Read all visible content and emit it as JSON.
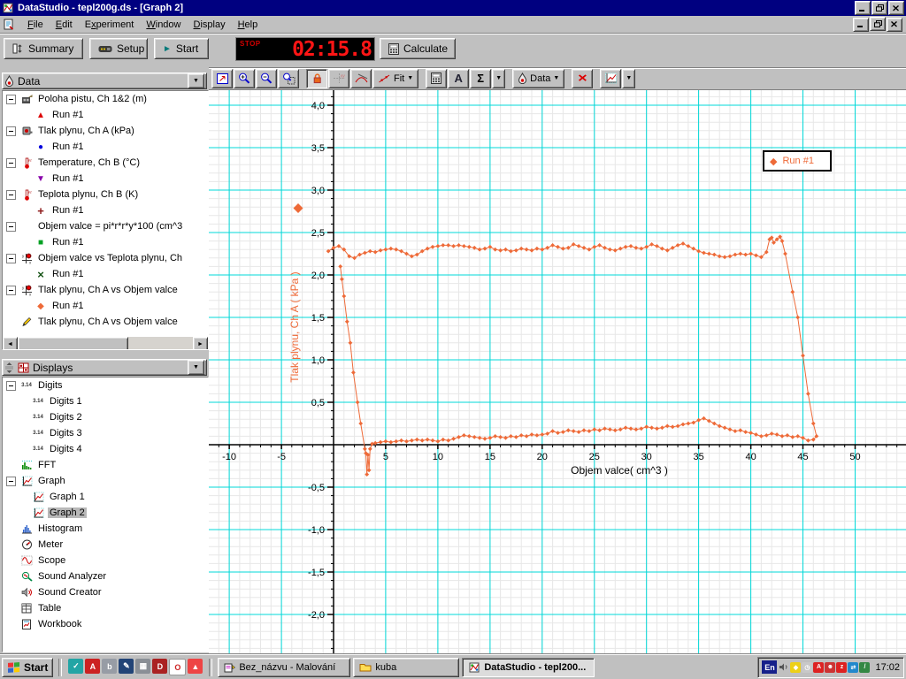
{
  "window": {
    "title": "DataStudio - tepl200g.ds - [Graph 2]",
    "app_icon": "datastudio-icon",
    "controls": [
      "minimize",
      "restore",
      "close"
    ],
    "child_controls": [
      "minimize",
      "restore",
      "close"
    ]
  },
  "menu": {
    "doc_icon": "document-icon",
    "items": [
      {
        "label": "File",
        "u": 0
      },
      {
        "label": "Edit",
        "u": 0
      },
      {
        "label": "Experiment",
        "u": 1
      },
      {
        "label": "Window",
        "u": 0
      },
      {
        "label": "Display",
        "u": 0
      },
      {
        "label": "Help",
        "u": 0
      }
    ]
  },
  "toolbar": {
    "summary_label": "Summary",
    "setup_label": "Setup",
    "start_label": "Start",
    "timer": {
      "status": "STOP",
      "value": "02:15.8"
    },
    "calculate_label": "Calculate"
  },
  "graph_toolbar": {
    "buttons": [
      {
        "name": "scale-to-fit"
      },
      {
        "name": "zoom-in"
      },
      {
        "name": "zoom-out"
      },
      {
        "name": "zoom-select"
      },
      {
        "name": "smart-tool",
        "pressed": true,
        "gapBefore": true
      },
      {
        "name": "xy-tool",
        "disabled": true
      },
      {
        "name": "slope-tool"
      },
      {
        "name": "fit",
        "label": "Fit",
        "arrow": true
      },
      {
        "name": "calculator",
        "gapBefore": true
      },
      {
        "name": "text-tool"
      },
      {
        "name": "statistics"
      },
      {
        "name": "statistics-arrow",
        "arrowOnly": true
      },
      {
        "name": "data",
        "label": "Data",
        "arrow": true,
        "gapBefore": true
      },
      {
        "name": "delete",
        "gapBefore": true
      },
      {
        "name": "graph-settings",
        "gapBefore": true
      },
      {
        "name": "graph-settings-arrow",
        "arrowOnly": true
      }
    ]
  },
  "sidebar": {
    "data_panel": {
      "title": "Data",
      "header_icon": "droplet-icon",
      "items": [
        {
          "icon": "motion-sensor",
          "label": "Poloha pistu, Ch 1&2 (m)",
          "expand": true,
          "runs": [
            {
              "marker": "triangle-up",
              "color": "#dd0000",
              "label": "Run #1"
            }
          ]
        },
        {
          "icon": "pressure-sensor",
          "label": "Tlak plynu, Ch A (kPa)",
          "expand": true,
          "runs": [
            {
              "marker": "circle",
              "color": "#0000dd",
              "label": "Run #1"
            }
          ]
        },
        {
          "icon": "thermometer",
          "label": "Temperature, Ch B (°C)",
          "expand": true,
          "runs": [
            {
              "marker": "triangle-down",
              "color": "#8800aa",
              "label": "Run #1"
            }
          ]
        },
        {
          "icon": "thermometer",
          "label": "Teplota plynu, Ch B (K)",
          "expand": true,
          "runs": [
            {
              "marker": "plus",
              "color": "#8b1515",
              "label": "Run #1"
            }
          ]
        },
        {
          "icon": "calculator",
          "label": "Objem valce = pi*r*r*y*100 (cm^3",
          "expand": true,
          "runs": [
            {
              "marker": "square",
              "color": "#00a022",
              "label": "Run #1"
            }
          ]
        },
        {
          "icon": "xy-graph",
          "label": "Objem valce vs Teplota plynu, Ch",
          "expand": true,
          "runs": [
            {
              "marker": "x",
              "color": "#145214",
              "label": "Run #1"
            }
          ]
        },
        {
          "icon": "xy-graph",
          "label": "Tlak plynu, Ch A vs Objem valce",
          "expand": true,
          "runs": [
            {
              "marker": "diamond",
              "color": "#ee6a38",
              "label": "Run #1"
            }
          ]
        },
        {
          "icon": "pencil",
          "label": "Tlak plynu, Ch A vs Objem valce",
          "expand": false,
          "runs": []
        }
      ]
    },
    "displays_panel": {
      "title": "Displays",
      "header_icon": "displays-grid-icon",
      "splitter_icon": "splitter-icon",
      "items": [
        {
          "icon": "digits",
          "label": "Digits",
          "expand": true,
          "children": [
            "Digits 1",
            "Digits 2",
            "Digits 3",
            "Digits 4"
          ]
        },
        {
          "icon": "fft",
          "label": "FFT"
        },
        {
          "icon": "graph",
          "label": "Graph",
          "expand": true,
          "children": [
            "Graph 1",
            "Graph 2"
          ],
          "selected_child": "Graph 2"
        },
        {
          "icon": "histogram",
          "label": "Histogram"
        },
        {
          "icon": "meter",
          "label": "Meter"
        },
        {
          "icon": "scope",
          "label": "Scope"
        },
        {
          "icon": "sound-analyzer",
          "label": "Sound Analyzer"
        },
        {
          "icon": "sound-creator",
          "label": "Sound Creator"
        },
        {
          "icon": "table",
          "label": "Table"
        },
        {
          "icon": "workbook",
          "label": "Workbook"
        }
      ]
    }
  },
  "chart_data": {
    "type": "scatter",
    "title": "",
    "xlabel": "Objem valce( cm^3 )",
    "ylabel": "Tlak plynu, Ch A ( kPa )",
    "decimal_separator": ",",
    "x_ticks": [
      -10,
      -5,
      5,
      10,
      15,
      20,
      25,
      30,
      35,
      40,
      45,
      50
    ],
    "y_ticks": [
      -2.0,
      -1.5,
      -1.0,
      -0.5,
      0.5,
      1.0,
      1.5,
      2.0,
      2.5,
      3.0,
      3.5,
      4.0
    ],
    "xlim": [
      -12,
      55
    ],
    "ylim": [
      -2.47,
      4.17
    ],
    "x_minor_step": 1,
    "y_minor_step": 0.1,
    "grid": {
      "major_color": "#00d8d8",
      "minor_color": "#e7e7e7"
    },
    "legend": [
      {
        "label": "Run #1",
        "marker": "diamond",
        "color": "#ee6a38"
      }
    ],
    "legend_position": "top-right",
    "series": [
      {
        "name": "Run #1",
        "color": "#ee6a38",
        "marker": "diamond",
        "points": [
          [
            -0.5,
            2.28
          ],
          [
            0,
            2.32
          ],
          [
            0.5,
            2.34
          ],
          [
            1,
            2.3
          ],
          [
            1.5,
            2.22
          ],
          [
            2,
            2.2
          ],
          [
            2.5,
            2.24
          ],
          [
            3,
            2.26
          ],
          [
            3.5,
            2.28
          ],
          [
            4,
            2.27
          ],
          [
            4.5,
            2.29
          ],
          [
            5,
            2.3
          ],
          [
            5.5,
            2.31
          ],
          [
            6,
            2.3
          ],
          [
            6.5,
            2.28
          ],
          [
            7,
            2.25
          ],
          [
            7.5,
            2.22
          ],
          [
            8,
            2.24
          ],
          [
            8.5,
            2.28
          ],
          [
            9,
            2.31
          ],
          [
            9.5,
            2.33
          ],
          [
            10,
            2.34
          ],
          [
            10.5,
            2.35
          ],
          [
            11,
            2.35
          ],
          [
            11.5,
            2.34
          ],
          [
            12,
            2.35
          ],
          [
            12.5,
            2.34
          ],
          [
            13,
            2.33
          ],
          [
            13.5,
            2.32
          ],
          [
            14,
            2.3
          ],
          [
            14.5,
            2.31
          ],
          [
            15,
            2.33
          ],
          [
            15.5,
            2.3
          ],
          [
            16,
            2.29
          ],
          [
            16.5,
            2.3
          ],
          [
            17,
            2.28
          ],
          [
            17.5,
            2.29
          ],
          [
            18,
            2.31
          ],
          [
            18.5,
            2.3
          ],
          [
            19,
            2.29
          ],
          [
            19.5,
            2.31
          ],
          [
            20,
            2.3
          ],
          [
            20.5,
            2.32
          ],
          [
            21,
            2.35
          ],
          [
            21.5,
            2.33
          ],
          [
            22,
            2.31
          ],
          [
            22.5,
            2.32
          ],
          [
            23,
            2.36
          ],
          [
            23.5,
            2.34
          ],
          [
            24,
            2.32
          ],
          [
            24.5,
            2.3
          ],
          [
            25,
            2.33
          ],
          [
            25.5,
            2.35
          ],
          [
            26,
            2.32
          ],
          [
            26.5,
            2.3
          ],
          [
            27,
            2.29
          ],
          [
            27.5,
            2.31
          ],
          [
            28,
            2.33
          ],
          [
            28.5,
            2.34
          ],
          [
            29,
            2.32
          ],
          [
            29.5,
            2.31
          ],
          [
            30,
            2.33
          ],
          [
            30.5,
            2.36
          ],
          [
            31,
            2.34
          ],
          [
            31.5,
            2.31
          ],
          [
            32,
            2.29
          ],
          [
            32.5,
            2.32
          ],
          [
            33,
            2.35
          ],
          [
            33.5,
            2.37
          ],
          [
            34,
            2.34
          ],
          [
            34.5,
            2.31
          ],
          [
            35,
            2.28
          ],
          [
            35.5,
            2.26
          ],
          [
            36,
            2.25
          ],
          [
            36.5,
            2.24
          ],
          [
            37,
            2.22
          ],
          [
            37.5,
            2.21
          ],
          [
            38,
            2.22
          ],
          [
            38.5,
            2.24
          ],
          [
            39,
            2.25
          ],
          [
            39.5,
            2.24
          ],
          [
            40,
            2.25
          ],
          [
            40.5,
            2.23
          ],
          [
            41,
            2.21
          ],
          [
            41.5,
            2.27
          ],
          [
            41.8,
            2.42
          ],
          [
            42,
            2.44
          ],
          [
            42.2,
            2.38
          ],
          [
            42.5,
            2.42
          ],
          [
            42.8,
            2.45
          ],
          [
            43,
            2.4
          ],
          [
            43.3,
            2.25
          ],
          [
            44,
            1.8
          ],
          [
            44.5,
            1.5
          ],
          [
            45,
            1.05
          ],
          [
            45.5,
            0.6
          ],
          [
            46,
            0.25
          ],
          [
            46.3,
            0.1
          ],
          [
            46,
            0.06
          ],
          [
            45.5,
            0.05
          ],
          [
            45,
            0.08
          ],
          [
            44.5,
            0.1
          ],
          [
            44,
            0.09
          ],
          [
            43.5,
            0.11
          ],
          [
            43,
            0.1
          ],
          [
            42.5,
            0.12
          ],
          [
            42,
            0.13
          ],
          [
            41.5,
            0.11
          ],
          [
            41,
            0.1
          ],
          [
            40.5,
            0.12
          ],
          [
            40,
            0.14
          ],
          [
            39.5,
            0.15
          ],
          [
            39,
            0.17
          ],
          [
            38.5,
            0.16
          ],
          [
            38,
            0.18
          ],
          [
            37.5,
            0.2
          ],
          [
            37,
            0.22
          ],
          [
            36.5,
            0.25
          ],
          [
            36,
            0.28
          ],
          [
            35.5,
            0.31
          ],
          [
            35,
            0.29
          ],
          [
            34.5,
            0.26
          ],
          [
            34,
            0.25
          ],
          [
            33.5,
            0.24
          ],
          [
            33,
            0.22
          ],
          [
            32.5,
            0.21
          ],
          [
            32,
            0.22
          ],
          [
            31.5,
            0.2
          ],
          [
            31,
            0.19
          ],
          [
            30.5,
            0.2
          ],
          [
            30,
            0.21
          ],
          [
            29.5,
            0.19
          ],
          [
            29,
            0.18
          ],
          [
            28.5,
            0.19
          ],
          [
            28,
            0.2
          ],
          [
            27.5,
            0.18
          ],
          [
            27,
            0.17
          ],
          [
            26.5,
            0.18
          ],
          [
            26,
            0.19
          ],
          [
            25.5,
            0.17
          ],
          [
            25,
            0.18
          ],
          [
            24.5,
            0.16
          ],
          [
            24,
            0.17
          ],
          [
            23.5,
            0.15
          ],
          [
            23,
            0.16
          ],
          [
            22.5,
            0.17
          ],
          [
            22,
            0.15
          ],
          [
            21.5,
            0.14
          ],
          [
            21,
            0.16
          ],
          [
            20.5,
            0.13
          ],
          [
            20,
            0.12
          ],
          [
            19.5,
            0.11
          ],
          [
            19,
            0.12
          ],
          [
            18.5,
            0.1
          ],
          [
            18,
            0.11
          ],
          [
            17.5,
            0.09
          ],
          [
            17,
            0.1
          ],
          [
            16.5,
            0.08
          ],
          [
            16,
            0.09
          ],
          [
            15.5,
            0.1
          ],
          [
            15,
            0.08
          ],
          [
            14.5,
            0.07
          ],
          [
            14,
            0.08
          ],
          [
            13.5,
            0.09
          ],
          [
            13,
            0.1
          ],
          [
            12.5,
            0.11
          ],
          [
            12,
            0.09
          ],
          [
            11.5,
            0.07
          ],
          [
            11,
            0.05
          ],
          [
            10.5,
            0.06
          ],
          [
            10,
            0.04
          ],
          [
            9.5,
            0.05
          ],
          [
            9,
            0.06
          ],
          [
            8.5,
            0.05
          ],
          [
            8,
            0.06
          ],
          [
            7.5,
            0.05
          ],
          [
            7,
            0.04
          ],
          [
            6.5,
            0.05
          ],
          [
            6,
            0.04
          ],
          [
            5.5,
            0.03
          ],
          [
            5,
            0.04
          ],
          [
            4.5,
            0.03
          ],
          [
            4,
            0.02
          ],
          [
            3.7,
            0.01
          ],
          [
            3.5,
            -0.05
          ],
          [
            3.4,
            -0.3
          ],
          [
            3.3,
            -0.12
          ],
          [
            3.2,
            -0.35
          ],
          [
            3.1,
            -0.1
          ],
          [
            3,
            -0.05
          ],
          [
            2.6,
            0.25
          ],
          [
            2.3,
            0.5
          ],
          [
            1.9,
            0.85
          ],
          [
            1.6,
            1.2
          ],
          [
            1.3,
            1.45
          ],
          [
            1,
            1.75
          ],
          [
            0.8,
            1.95
          ],
          [
            0.65,
            2.1
          ]
        ]
      }
    ]
  },
  "taskbar": {
    "start_label": "Start",
    "start_icon": "windows-logo-icon",
    "quick_launch": [
      "notes-icon",
      "acrobat-icon",
      "bird-icon",
      "pen-icon",
      "calculator-tray-icon",
      "dragon-icon",
      "opera-icon",
      "flame-icon"
    ],
    "tasks": [
      {
        "icon": "paint-icon",
        "label": "Bez_názvu - Malování",
        "active": false
      },
      {
        "icon": "folder-icon",
        "label": "kuba",
        "active": false
      },
      {
        "icon": "datastudio-icon",
        "label": "DataStudio - tepl200...",
        "active": true
      }
    ],
    "tray": {
      "language": "En",
      "icons": [
        "volume-icon",
        "diamond-icon",
        "scheduler-icon",
        "ati-icon",
        "agent-icon",
        "power-icon",
        "sync-icon",
        "pen-tray-icon"
      ],
      "time": "17:02"
    }
  },
  "colors": {
    "title_bar": "#000080",
    "accent_orange": "#ee6a38",
    "timer_red": "#ff1515",
    "grid_major": "#00d8d8",
    "grid_minor": "#e7e7e7"
  }
}
